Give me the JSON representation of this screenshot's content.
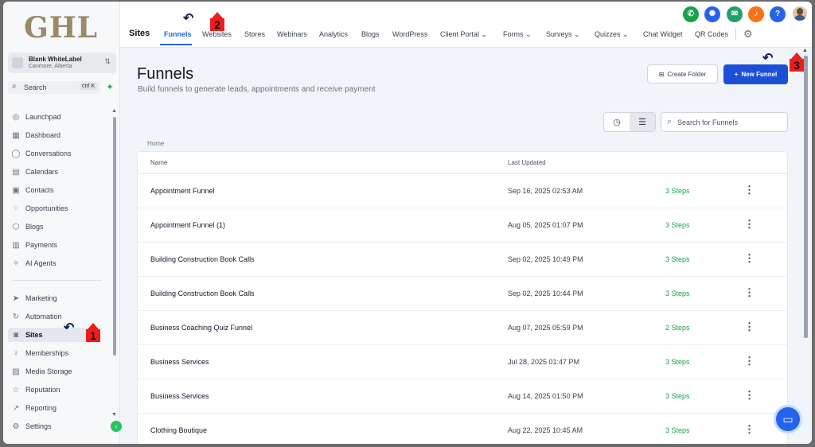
{
  "sidebar": {
    "logo": "GHL",
    "account": {
      "name": "Blank WhiteLabel",
      "location": "Canmore, Alberta"
    },
    "search": {
      "label": "Search",
      "shortcut": "ctrl K"
    },
    "items": [
      {
        "label": "Launchpad",
        "icon": "rocket-icon"
      },
      {
        "label": "Dashboard",
        "icon": "grid-icon"
      },
      {
        "label": "Conversations",
        "icon": "chat-icon"
      },
      {
        "label": "Calendars",
        "icon": "calendar-icon"
      },
      {
        "label": "Contacts",
        "icon": "contacts-icon"
      },
      {
        "label": "Opportunities",
        "icon": "opportunities-icon"
      },
      {
        "label": "Blogs",
        "icon": "cube-icon"
      },
      {
        "label": "Payments",
        "icon": "receipt-icon"
      },
      {
        "label": "AI Agents",
        "icon": "sparkle-icon"
      },
      {
        "label": "Marketing",
        "icon": "send-icon"
      },
      {
        "label": "Automation",
        "icon": "automation-icon"
      },
      {
        "label": "Sites",
        "icon": "globe-icon"
      },
      {
        "label": "Memberships",
        "icon": "badge-icon"
      },
      {
        "label": "Media Storage",
        "icon": "image-icon"
      },
      {
        "label": "Reputation",
        "icon": "star-icon"
      },
      {
        "label": "Reporting",
        "icon": "chart-icon"
      },
      {
        "label": "Settings",
        "icon": "gear-icon"
      }
    ]
  },
  "topnav": {
    "section": "Sites",
    "tabs": [
      "Funnels",
      "Websites",
      "Stores",
      "Webinars",
      "Analytics",
      "Blogs",
      "WordPress",
      "Client Portal",
      "Forms",
      "Surveys",
      "Quizzes",
      "Chat Widget",
      "QR Codes"
    ]
  },
  "page": {
    "title": "Funnels",
    "subtitle": "Build funnels to generate leads, appointments and receive payment",
    "create_folder": "Create Folder",
    "new_funnel": "New Funnel",
    "search_placeholder": "Search for Funnels",
    "breadcrumb": "Home",
    "columns": {
      "name": "Name",
      "updated": "Last Updated"
    }
  },
  "funnels": [
    {
      "name": "Appointment Funnel",
      "updated": "Sep 16, 2025 02:53 AM",
      "steps": "3 Steps"
    },
    {
      "name": "Appointment Funnel (1)",
      "updated": "Aug 05, 2025 01:07 PM",
      "steps": "3 Steps"
    },
    {
      "name": "Building Construction Book Calls",
      "updated": "Sep 02, 2025 10:49 PM",
      "steps": "3 Steps"
    },
    {
      "name": "Building Construction Book Calls",
      "updated": "Sep 02, 2025 10:44 PM",
      "steps": "3 Steps"
    },
    {
      "name": "Business Coaching Quiz Funnel",
      "updated": "Aug 07, 2025 05:59 PM",
      "steps": "2 Steps"
    },
    {
      "name": "Business Services",
      "updated": "Jul 28, 2025 01:47 PM",
      "steps": "3 Steps"
    },
    {
      "name": "Business Services",
      "updated": "Aug 14, 2025 01:50 PM",
      "steps": "3 Steps"
    },
    {
      "name": "Clothing Boutique",
      "updated": "Aug 22, 2025 10:45 AM",
      "steps": "3 Steps"
    }
  ],
  "annotations": [
    "1",
    "2",
    "3"
  ],
  "colors": {
    "accent": "#2563eb",
    "steps": "#16a34a",
    "annotation": "#ef1c1c"
  }
}
